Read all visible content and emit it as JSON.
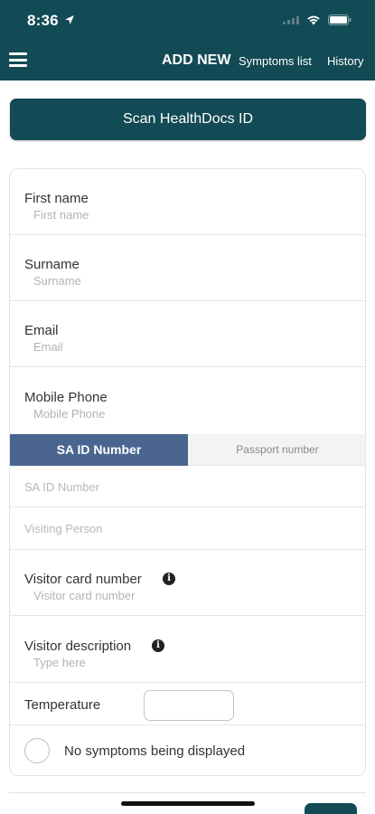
{
  "status_bar": {
    "time": "8:36",
    "location_icon": "location-arrow-icon",
    "signal_icon": "cellular-signal-icon",
    "wifi_icon": "wifi-icon",
    "battery_icon": "battery-icon"
  },
  "header": {
    "menu_icon": "hamburger-menu-icon",
    "title": "ADD NEW",
    "nav": {
      "symptoms": "Symptoms list",
      "history": "History"
    }
  },
  "scan_button": {
    "label": "Scan HealthDocs ID"
  },
  "form": {
    "first_name": {
      "label": "First name",
      "placeholder": "First name"
    },
    "surname": {
      "label": "Surname",
      "placeholder": "Surname"
    },
    "email": {
      "label": "Email",
      "placeholder": "Email"
    },
    "mobile_phone": {
      "label": "Mobile Phone",
      "placeholder": "Mobile Phone"
    },
    "id_toggle": {
      "active": "SA ID Number",
      "inactive": "Passport number"
    },
    "sa_id_number": {
      "placeholder": "SA ID Number"
    },
    "visiting_person": {
      "placeholder": "Visiting Person"
    },
    "visitor_card_number": {
      "label": "Visitor card number",
      "placeholder": "Visitor card number",
      "info_icon": "info-icon"
    },
    "visitor_description": {
      "label": "Visitor description",
      "placeholder": "Type here",
      "info_icon": "info-icon"
    },
    "temperature": {
      "label": "Temperature",
      "value": ""
    },
    "symptoms": {
      "label": "No symptoms being displayed",
      "checked": false
    }
  },
  "colors": {
    "primary": "#124a55",
    "toggle_active": "#4a6590",
    "toggle_inactive": "#f3f3f3"
  }
}
